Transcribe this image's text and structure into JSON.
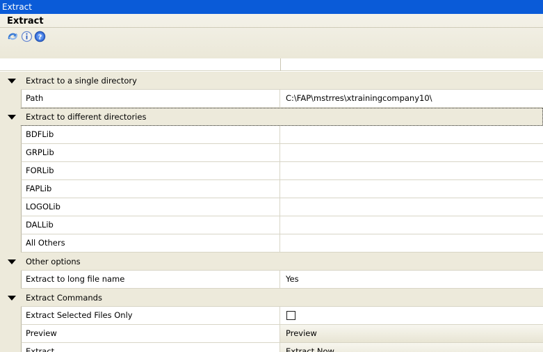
{
  "window": {
    "title": "Extract"
  },
  "panel": {
    "title": "Extract",
    "toolbar": [
      {
        "icon": "refresh-icon",
        "label": ""
      },
      {
        "icon": "info-icon",
        "label": ""
      },
      {
        "icon": "help-icon",
        "label": ""
      }
    ]
  },
  "categories": [
    {
      "label": "Extract to a single directory",
      "props": [
        {
          "name": "Path",
          "value": "C:\\FAP\\mstrres\\xtrainingcompany10\\"
        }
      ]
    },
    {
      "label": "Extract to different directories",
      "props": [
        {
          "name": "BDFLib",
          "value": ""
        },
        {
          "name": "GRPLib",
          "value": ""
        },
        {
          "name": "FORLib",
          "value": ""
        },
        {
          "name": "FAPLib",
          "value": ""
        },
        {
          "name": "LOGOLib",
          "value": ""
        },
        {
          "name": "DALLib",
          "value": ""
        },
        {
          "name": "All Others",
          "value": ""
        }
      ]
    },
    {
      "label": "Other options",
      "props": [
        {
          "name": "Extract to long file name",
          "value": "Yes"
        }
      ]
    },
    {
      "label": "Extract Commands",
      "props": [
        {
          "name": "Extract Selected Files Only",
          "value": "",
          "checked": false
        },
        {
          "name": "Preview",
          "value": "Preview"
        },
        {
          "name": "Extract",
          "value": "Extract Now"
        }
      ]
    }
  ],
  "colors": {
    "titlebar": "#0a5bd8",
    "category_bg": "#edeadb",
    "accent_icon": "#3a7bd5"
  }
}
